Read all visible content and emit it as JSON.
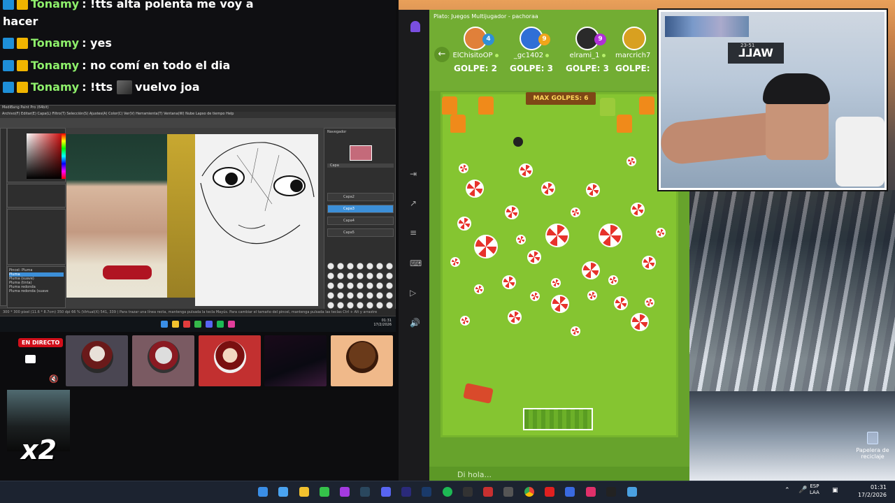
{
  "chat": {
    "lines": [
      {
        "user": "Tonamy",
        "text": ": !tts alta polenta me voy a"
      },
      {
        "user": "",
        "text": "hacer"
      },
      {
        "user": "Tonamy",
        "text": ": yes"
      },
      {
        "user": "Tonamy",
        "text": ": no comí en todo el dia"
      },
      {
        "user": "Tonamy",
        "text": ": !tts",
        "text_after": "vuelvo joa"
      }
    ]
  },
  "paint": {
    "title": "MediBang Paint Pro (64bit)",
    "menu": "Archivo(F)   Editar(E)   Capa(L)   Filtro(T)   Selección(S)   Ajustes(A)   Color(C)   Ver(V)   Herramienta(T)   Ventana(W)   Nube   Lapso de tiempo   Help",
    "layers_title": "Navegador",
    "layers_panel": "Capa",
    "layers": [
      "Capa2",
      "Capa3",
      "Capa4",
      "Capa5"
    ],
    "brush_title": "Pincel: Pluma",
    "brushes": [
      "Pluma",
      "Pluma (suave)",
      "Pluma (tinta)",
      "Pluma redonda",
      "Pluma redonda (suave"
    ],
    "status": "300 * 300 pixel (11.6 * 8.7cm) 350 dpi 66 % (Virtual(X) 541, 339 ) Para trazar una línea recta, mantenga pulsada la tecla Mayús. Para cambiar el tamaño del pincel, mantenga pulsada las teclas Ctrl + Alt y arrastre",
    "inner_clock_time": "01:31",
    "inner_clock_date": "17/2/2026"
  },
  "stream": {
    "live_label": "EN DIRECTO",
    "multiplier": "x2"
  },
  "game": {
    "window_title": "Plato: Juegos Multijugador - pachoraa",
    "max_label": "MAX GOLPES: 6",
    "players": [
      {
        "name": "ElChisitoOP",
        "level": "4",
        "score": "GOLPE: 2",
        "level_color": "#2f8fd6"
      },
      {
        "name": "_gc1402",
        "level": "9",
        "score": "GOLPE: 3",
        "level_color": "#f0a51a"
      },
      {
        "name": "elrami_1",
        "level": "9",
        "score": "GOLPE: 3",
        "level_color": "#b02fd6"
      },
      {
        "name": "marcrich7",
        "level": "",
        "score": "GOLPE:",
        "level_color": "#f0a51a"
      }
    ],
    "chat_placeholder": "Di hola..."
  },
  "webcam": {
    "sign_text": "WALL",
    "sign_sub": "23-51"
  },
  "desktop": {
    "recycle_label": "Papelera de reciclaje"
  },
  "taskbar": {
    "lang1": "ESP",
    "lang2": "LAA",
    "time": "01:31",
    "date": "17/2/2026"
  }
}
